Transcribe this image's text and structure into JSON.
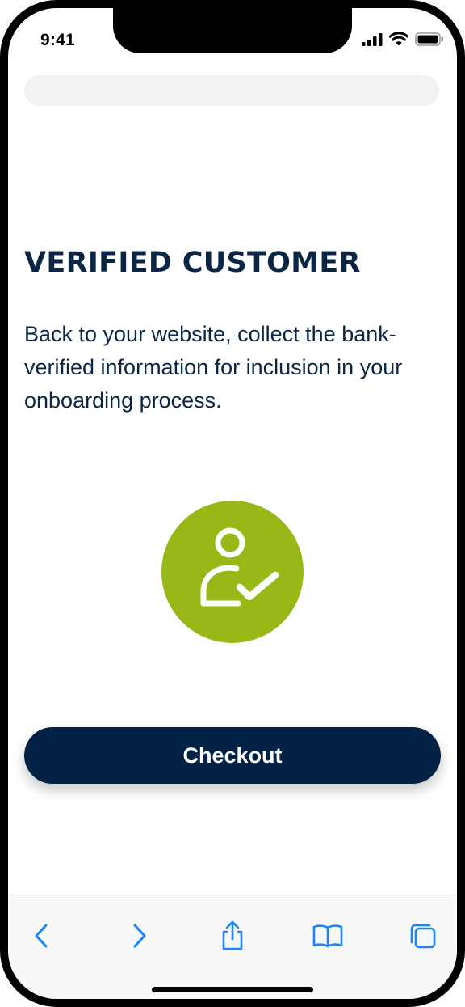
{
  "status_bar": {
    "time": "9:41",
    "icons": [
      "signal-icon",
      "wifi-icon",
      "battery-icon"
    ]
  },
  "browser": {
    "address_bar_text": "",
    "toolbar": {
      "items": [
        "back-icon",
        "forward-icon",
        "share-icon",
        "bookmarks-icon",
        "tabs-icon"
      ]
    }
  },
  "content": {
    "title": "VERIFIED CUSTOMER",
    "description": "Back to your website, collect the bank-verified information for inclusion in your onboarding process.",
    "badge_icon": "user-check-icon",
    "checkout_label": "Checkout"
  },
  "colors": {
    "primary_navy": "#012245",
    "heading_navy": "#0b2545",
    "badge_green": "#98b818",
    "ios_blue": "#1a84ff"
  }
}
